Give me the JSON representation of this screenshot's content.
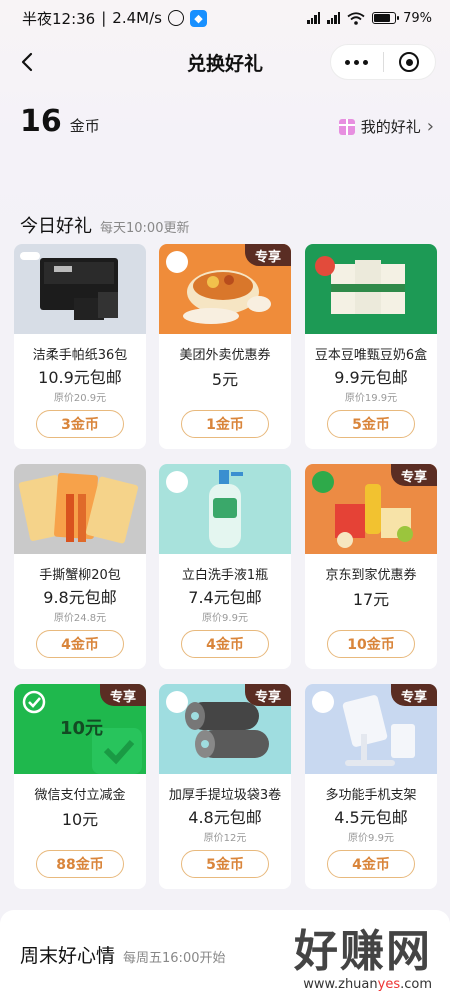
{
  "status_bar": {
    "time": "半夜12:36",
    "speed": "2.4M/s",
    "battery": "79%",
    "battery_level": 0.79
  },
  "nav": {
    "title": "兑换好礼"
  },
  "balance": {
    "amount": "16",
    "unit": "金币"
  },
  "my_gifts": {
    "label": "我的好礼",
    "chevron": "›"
  },
  "today_section": {
    "title": "今日好礼",
    "subtitle": "每天10:00更新"
  },
  "exclusive_tag": "专享",
  "products": [
    {
      "name": "洁柔手帕纸36包",
      "price": "10.9元包邮",
      "original": "原价20.9元",
      "cost": "3金币",
      "exclusive": false,
      "icon": "tissue-box-image"
    },
    {
      "name": "美团外卖优惠券",
      "price": "5元",
      "original": "",
      "cost": "1金币",
      "exclusive": true,
      "icon": "food-bowl-image"
    },
    {
      "name": "豆本豆唯甄豆奶6盒",
      "price": "9.9元包邮",
      "original": "原价19.9元",
      "cost": "5金币",
      "exclusive": false,
      "icon": "soy-milk-boxes-image"
    },
    {
      "name": "手撕蟹柳20包",
      "price": "9.8元包邮",
      "original": "原价24.8元",
      "cost": "4金币",
      "exclusive": false,
      "icon": "crab-stick-snacks-image"
    },
    {
      "name": "立白洗手液1瓶",
      "price": "7.4元包邮",
      "original": "原价9.9元",
      "cost": "4金币",
      "exclusive": false,
      "icon": "hand-soap-bottle-image"
    },
    {
      "name": "京东到家优惠券",
      "price": "17元",
      "original": "",
      "cost": "10金币",
      "exclusive": true,
      "icon": "groceries-image"
    },
    {
      "name": "微信支付立减金",
      "price": "10元",
      "original": "",
      "cost": "88金币",
      "exclusive": true,
      "icon": "wechat-pay-coupon-image",
      "coupon_text": "10元"
    },
    {
      "name": "加厚手提垃圾袋3卷",
      "price": "4.8元包邮",
      "original": "原价12元",
      "cost": "5金币",
      "exclusive": true,
      "icon": "garbage-bag-rolls-image"
    },
    {
      "name": "多功能手机支架",
      "price": "4.5元包邮",
      "original": "原价9.9元",
      "cost": "4金币",
      "exclusive": true,
      "icon": "phone-stand-image"
    }
  ],
  "weekend_section": {
    "title": "周末好心情",
    "subtitle": "每周五16:00开始"
  },
  "watermark": {
    "text": "好赚网",
    "url_prefix": "www.zhuan",
    "url_highlight": "yes",
    "url_suffix": ".com"
  },
  "colors": {
    "coin_accent": "#d9853b",
    "coin_border": "#e8b97d",
    "exclusive_tag_bg": "#5a2d23",
    "page_bg": "#f3f2f7"
  }
}
